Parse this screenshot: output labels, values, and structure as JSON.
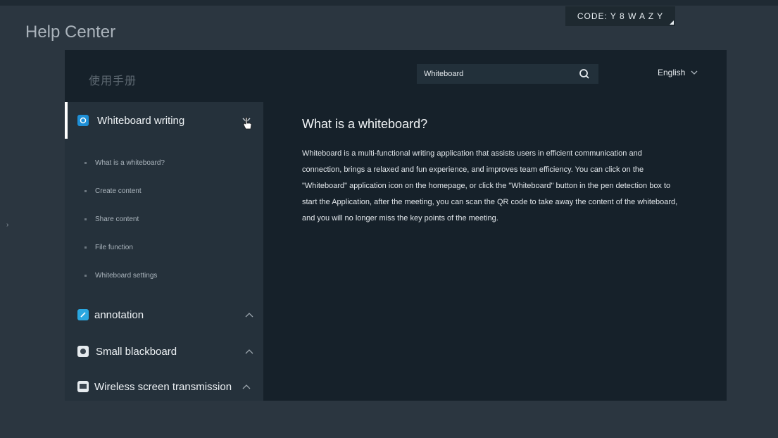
{
  "app": {
    "title": "Help Center"
  },
  "code_badge": {
    "label": "CODE: Y 8 W A Z Y"
  },
  "header": {
    "manual_title": "使用手册",
    "search": {
      "value": "Whiteboard"
    },
    "language": "English"
  },
  "sidebar": {
    "active_section": {
      "label": "Whiteboard writing",
      "icon": "whiteboard-app-icon"
    },
    "sub_items": [
      "What is a whiteboard?",
      "Create content",
      "Share content",
      "File function",
      "Whiteboard settings"
    ],
    "sections": [
      {
        "label": "annotation",
        "icon": "annotation-app-icon"
      },
      {
        "label": "Small blackboard",
        "icon": "blackboard-app-icon"
      },
      {
        "label": "Wireless screen transmission",
        "icon": "screen-transmission-app-icon"
      }
    ]
  },
  "article": {
    "title": "What is a whiteboard?",
    "body": "Whiteboard is a multi-functional writing application that assists users in efficient communication and connection, brings a relaxed and fun experience, and improves team efficiency. You can click on the \"Whiteboard\" application icon on the homepage, or click the \"Whiteboard\" button in the pen detection box to start the Application, after the meeting, you can scan the QR code to take away the content of the whiteboard, and you will no longer miss the key points of the meeting."
  },
  "colors": {
    "background": "#2b3640",
    "panel": "#16212a",
    "sidebar": "#25313b",
    "accent_blue": "#1e8fd6"
  }
}
